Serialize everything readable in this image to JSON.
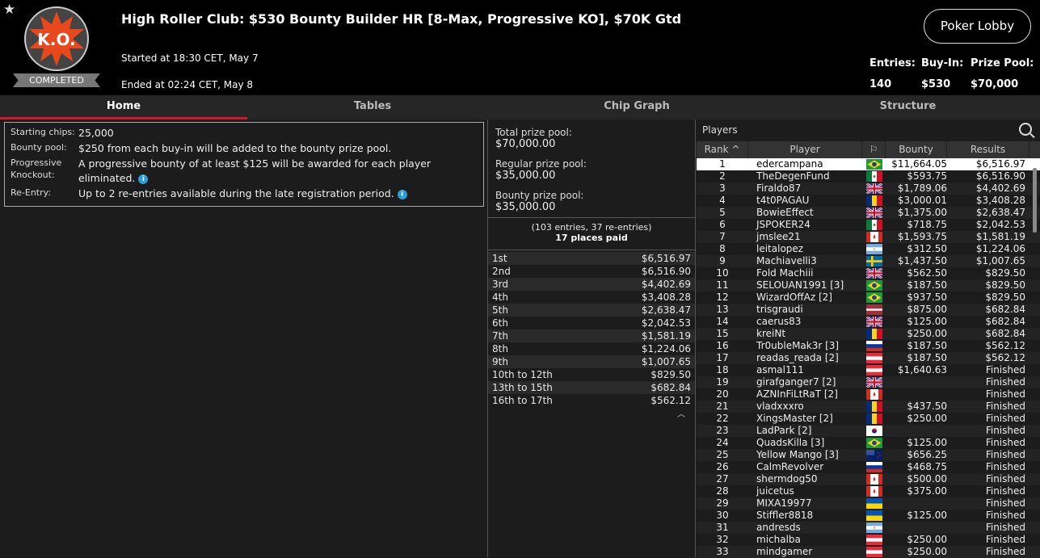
{
  "header": {
    "title": "High Roller Club: $530 Bounty Builder HR [8-Max, Progressive KO], $70K Gtd",
    "started": "Started at 18:30 CET, May 7",
    "ended": "Ended at 02:24 CET, May 8",
    "status_badge": "COMPLETED",
    "logo_text": "K.O.",
    "lobby_button": "Poker Lobby",
    "stats": [
      {
        "label": "Entries:",
        "value": "140"
      },
      {
        "label": "Buy-In:",
        "value": "$530"
      },
      {
        "label": "Prize Pool:",
        "value": "$70,000"
      }
    ]
  },
  "tabs": [
    "Home",
    "Tables",
    "Chip Graph",
    "Structure"
  ],
  "info": [
    {
      "key": "Starting chips:",
      "value": "25,000",
      "info_icon": false
    },
    {
      "key": "Bounty pool:",
      "value": "$250 from each buy-in will be added to the bounty prize pool.",
      "info_icon": false
    },
    {
      "key": "Progressive Knockout:",
      "value": "A progressive bounty of at least $125 will be awarded for each player eliminated.",
      "info_icon": true
    },
    {
      "key": "Re-Entry:",
      "value": "Up to 2 re-entries available during the late registration period.",
      "info_icon": true
    }
  ],
  "prize": {
    "total_label": "Total prize pool:",
    "total_value": "$70,000.00",
    "regular_label": "Regular prize pool:",
    "regular_value": "$35,000.00",
    "bounty_label": "Bounty prize pool:",
    "bounty_value": "$35,000.00",
    "entries_note": "(103 entries, 37 re-entries)",
    "places_paid": "17 places paid",
    "payouts": [
      {
        "place": "1st",
        "amount": "$6,516.97"
      },
      {
        "place": "2nd",
        "amount": "$6,516.90"
      },
      {
        "place": "3rd",
        "amount": "$4,402.69"
      },
      {
        "place": "4th",
        "amount": "$3,408.28"
      },
      {
        "place": "5th",
        "amount": "$2,638.47"
      },
      {
        "place": "6th",
        "amount": "$2,042.53"
      },
      {
        "place": "7th",
        "amount": "$1,581.19"
      },
      {
        "place": "8th",
        "amount": "$1,224.06"
      },
      {
        "place": "9th",
        "amount": "$1,007.65"
      },
      {
        "place": "10th to 12th",
        "amount": "$829.50"
      },
      {
        "place": "13th to 15th",
        "amount": "$682.84"
      },
      {
        "place": "16th to 17th",
        "amount": "$562.12"
      }
    ]
  },
  "players": {
    "title": "Players",
    "columns": [
      "Rank",
      "Player",
      "Bounty",
      "Results"
    ],
    "rows": [
      {
        "rank": "1",
        "name": "edercampana",
        "flag": "br",
        "bounty": "$11,664.05",
        "result": "$6,516.97"
      },
      {
        "rank": "2",
        "name": "TheDegenFund",
        "flag": "mx",
        "bounty": "$593.75",
        "result": "$6,516.90"
      },
      {
        "rank": "3",
        "name": "Firaldo87",
        "flag": "gb",
        "bounty": "$1,789.06",
        "result": "$4,402.69"
      },
      {
        "rank": "4",
        "name": "t4t0PAGAU",
        "flag": "ro",
        "bounty": "$3,000.01",
        "result": "$3,408.28"
      },
      {
        "rank": "5",
        "name": "BowieEffect",
        "flag": "gb",
        "bounty": "$1,375.00",
        "result": "$2,638.47"
      },
      {
        "rank": "6",
        "name": "JSPOKER24",
        "flag": "mx",
        "bounty": "$718.75",
        "result": "$2,042.53"
      },
      {
        "rank": "7",
        "name": "jmslee21",
        "flag": "ca",
        "bounty": "$1,593.75",
        "result": "$1,581.19"
      },
      {
        "rank": "8",
        "name": "leitalopez",
        "flag": "ar",
        "bounty": "$312.50",
        "result": "$1,224.06"
      },
      {
        "rank": "9",
        "name": "Machiavelli3",
        "flag": "se",
        "bounty": "$1,437.50",
        "result": "$1,007.65"
      },
      {
        "rank": "10",
        "name": "Fold Machiii",
        "flag": "gb",
        "bounty": "$562.50",
        "result": "$829.50"
      },
      {
        "rank": "11",
        "name": "SELOUAN1991 [3]",
        "flag": "br",
        "bounty": "$187.50",
        "result": "$829.50"
      },
      {
        "rank": "12",
        "name": "WizardOffAz [2]",
        "flag": "br",
        "bounty": "$937.50",
        "result": "$829.50"
      },
      {
        "rank": "13",
        "name": "trisgraudi",
        "flag": "lv",
        "bounty": "$875.00",
        "result": "$682.84"
      },
      {
        "rank": "14",
        "name": "caerus83",
        "flag": "gb",
        "bounty": "$125.00",
        "result": "$682.84"
      },
      {
        "rank": "15",
        "name": "kreiNt",
        "flag": "ro",
        "bounty": "$250.00",
        "result": "$682.84"
      },
      {
        "rank": "16",
        "name": "Tr0ubleMak3r [3]",
        "flag": "ru",
        "bounty": "$187.50",
        "result": "$562.12"
      },
      {
        "rank": "17",
        "name": "readas_reada [2]",
        "flag": "at",
        "bounty": "$187.50",
        "result": "$562.12"
      },
      {
        "rank": "18",
        "name": "asmal111",
        "flag": "at",
        "bounty": "$1,640.63",
        "result": "Finished"
      },
      {
        "rank": "19",
        "name": "girafganger7 [2]",
        "flag": "gb",
        "bounty": "",
        "result": "Finished"
      },
      {
        "rank": "20",
        "name": "AZNInFiLtRaT [2]",
        "flag": "ca",
        "bounty": "",
        "result": "Finished"
      },
      {
        "rank": "21",
        "name": "vladxxxro",
        "flag": "ro",
        "bounty": "$437.50",
        "result": "Finished"
      },
      {
        "rank": "22",
        "name": "XingsMaster [2]",
        "flag": "ro",
        "bounty": "$250.00",
        "result": "Finished"
      },
      {
        "rank": "23",
        "name": "LadPark [2]",
        "flag": "kr",
        "bounty": "",
        "result": "Finished"
      },
      {
        "rank": "24",
        "name": "QuadsKilla [3]",
        "flag": "br",
        "bounty": "$125.00",
        "result": "Finished"
      },
      {
        "rank": "25",
        "name": "Yellow Mango [3]",
        "flag": "nz",
        "bounty": "$656.25",
        "result": "Finished"
      },
      {
        "rank": "26",
        "name": "CalmRevolver",
        "flag": "ru",
        "bounty": "$468.75",
        "result": "Finished"
      },
      {
        "rank": "27",
        "name": "shermdog50",
        "flag": "ca",
        "bounty": "$500.00",
        "result": "Finished"
      },
      {
        "rank": "28",
        "name": "juicetus",
        "flag": "ca",
        "bounty": "$375.00",
        "result": "Finished"
      },
      {
        "rank": "29",
        "name": "MIXA19977",
        "flag": "ua",
        "bounty": "",
        "result": "Finished"
      },
      {
        "rank": "30",
        "name": "Stiffler8818",
        "flag": "ua",
        "bounty": "$125.00",
        "result": "Finished"
      },
      {
        "rank": "31",
        "name": "andresds",
        "flag": "ar",
        "bounty": "",
        "result": "Finished"
      },
      {
        "rank": "32",
        "name": "michalba",
        "flag": "at",
        "bounty": "$250.00",
        "result": "Finished"
      },
      {
        "rank": "33",
        "name": "mindgamer",
        "flag": "at",
        "bounty": "$250.00",
        "result": "Finished"
      }
    ]
  }
}
